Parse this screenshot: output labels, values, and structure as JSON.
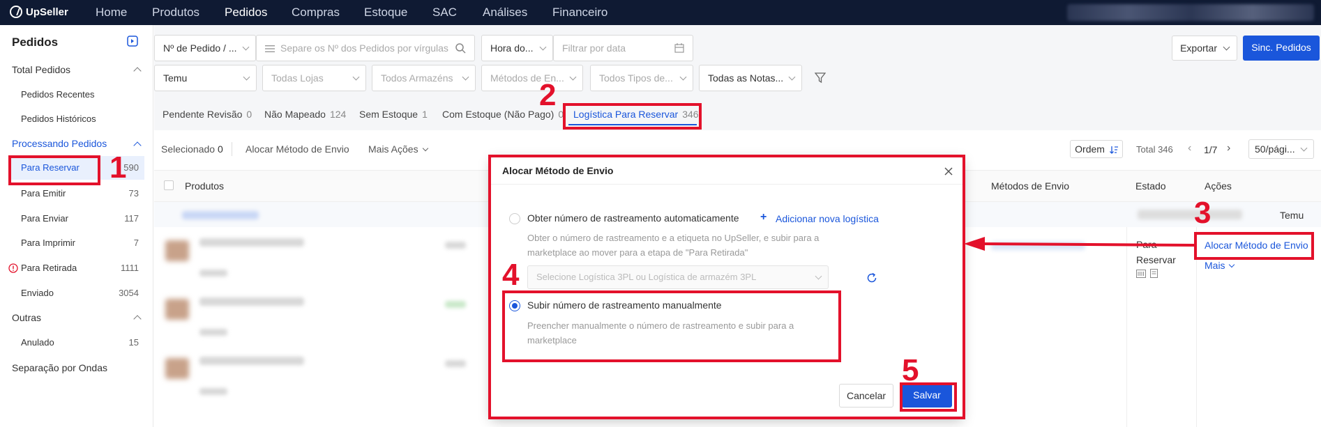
{
  "app": {
    "name": "UpSeller"
  },
  "nav": [
    "Home",
    "Produtos",
    "Pedidos",
    "Compras",
    "Estoque",
    "SAC",
    "Análises",
    "Financeiro"
  ],
  "sidebar": {
    "title": "Pedidos",
    "total_pedidos": "Total Pedidos",
    "recentes": "Pedidos Recentes",
    "historicos": "Pedidos Históricos",
    "processando": "Processando Pedidos",
    "items": [
      {
        "label": "Para Reservar",
        "count": "590"
      },
      {
        "label": "Para Emitir",
        "count": "73"
      },
      {
        "label": "Para Enviar",
        "count": "117"
      },
      {
        "label": "Para Imprimir",
        "count": "7"
      },
      {
        "label": "Para Retirada",
        "count": "1111"
      },
      {
        "label": "Enviado",
        "count": "3054"
      }
    ],
    "outras": "Outras",
    "anulado": {
      "label": "Anulado",
      "count": "15"
    },
    "separacao": "Separação por Ondas"
  },
  "filters": {
    "pedido_type": "Nº de Pedido / ...",
    "search_placeholder": "Separe os Nº dos Pedidos por vírgulas",
    "hora": "Hora do...",
    "date_placeholder": "Filtrar por data",
    "loja_platform": "Temu",
    "lojas": "Todas Lojas",
    "armazens": "Todos Armazéns",
    "metodos": "Métodos de En...",
    "tipos": "Todos Tipos de...",
    "notas": "Todas as Notas..."
  },
  "header_buttons": {
    "exportar": "Exportar",
    "sinc": "Sinc. Pedidos"
  },
  "tabs": [
    {
      "label": "Pendente Revisão",
      "count": "0"
    },
    {
      "label": "Não Mapeado",
      "count": "124"
    },
    {
      "label": "Sem Estoque",
      "count": "1"
    },
    {
      "label": "Com Estoque (Não Pago)",
      "count": "0"
    },
    {
      "label": "Logística Para Reservar",
      "count": "346"
    }
  ],
  "toolbar": {
    "selecionado": "Selecionado",
    "selecionado_count": "0",
    "alocar": "Alocar Método de Envio",
    "mais_acoes": "Mais Ações",
    "ordem": "Ordem",
    "total": "Total 346",
    "page": "1/7",
    "per_page": "50/pági..."
  },
  "table": {
    "col_produtos": "Produtos",
    "col_metodos": "Métodos de Envio",
    "col_estado": "Estado",
    "col_acoes": "Ações",
    "store": "Temu",
    "estado_line1": "Para",
    "estado_line2": "Reservar",
    "acao_alocar": "Alocar Método de Envio",
    "acao_mais": "Mais"
  },
  "dialog": {
    "title": "Alocar Método de Envio",
    "opt1_label": "Obter número de rastreamento automaticamente",
    "add_logistica": "Adicionar nova logística",
    "opt1_desc": "Obter o número de rastreamento e a etiqueta no UpSeller, e subir para a marketplace ao mover para a etapa de \"Para Retirada\"",
    "select_placeholder": "Selecione Logística 3PL ou Logística de armazém 3PL",
    "opt2_label": "Subir número de rastreamento manualmente",
    "opt2_desc": "Preencher manualmente o número de rastreamento e subir para a marketplace",
    "cancel": "Cancelar",
    "save": "Salvar"
  },
  "annotations": [
    "1",
    "2",
    "3",
    "4",
    "5"
  ],
  "colors": {
    "accent": "#1a56db",
    "topbar": "#0f1a33",
    "annotation": "#e3112b"
  }
}
